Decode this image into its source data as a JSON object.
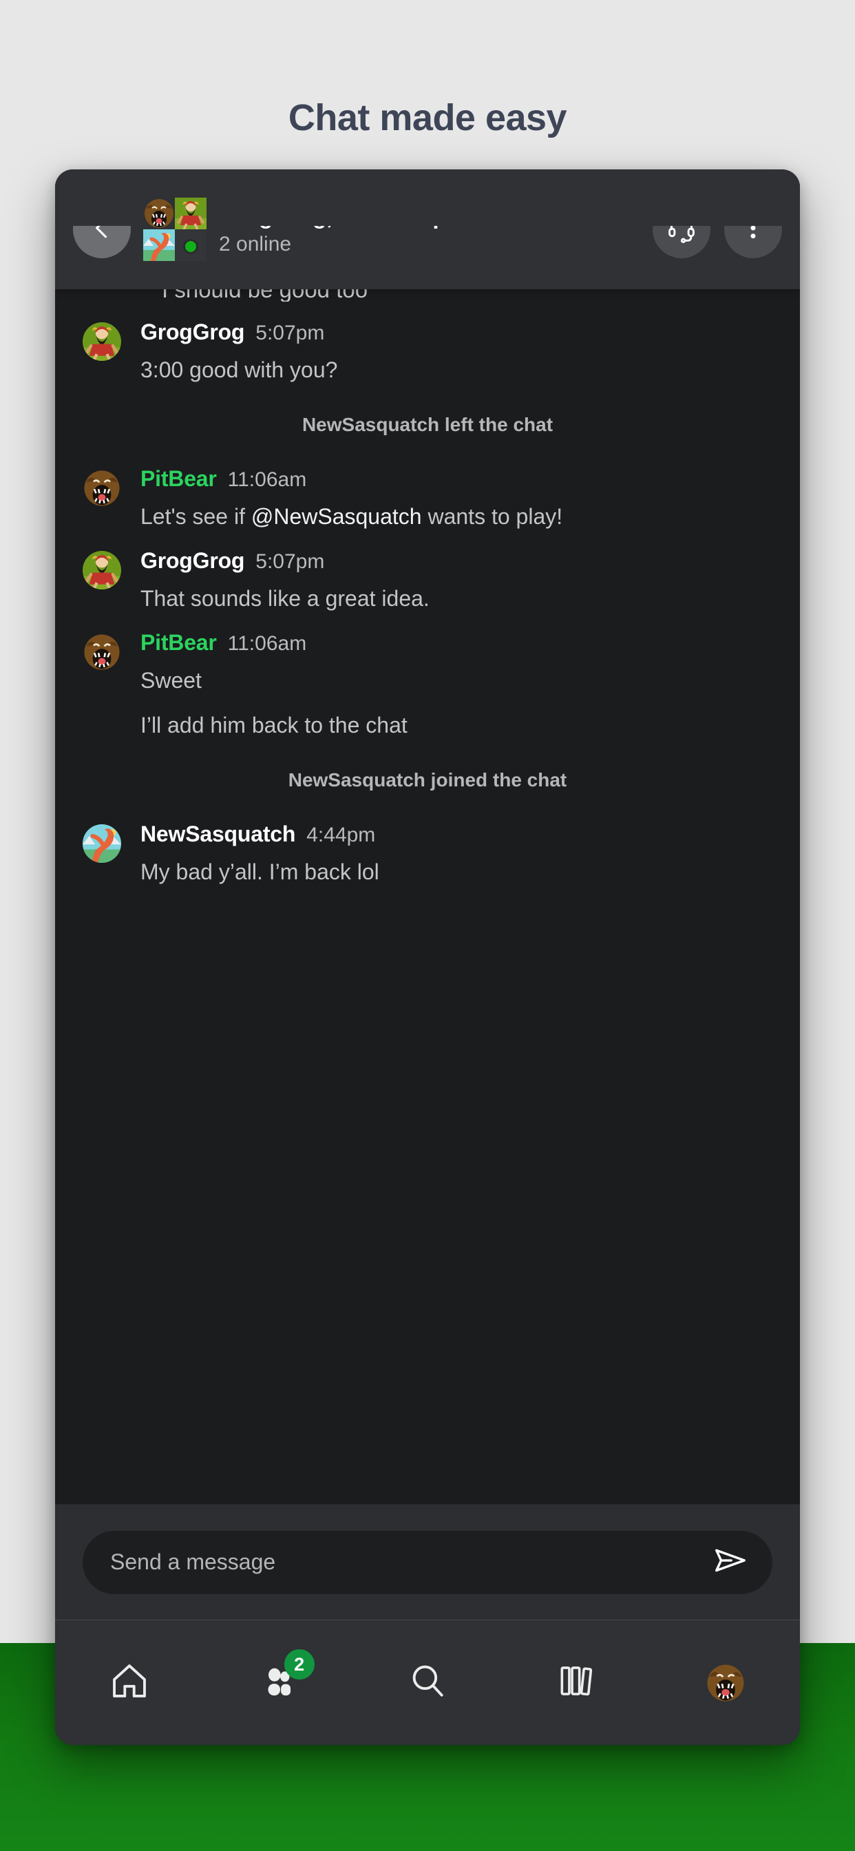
{
  "page": {
    "title": "Chat made easy",
    "background_color": "#e7e7e7",
    "accent_green": "#137a12",
    "title_color": "#3e4557"
  },
  "header": {
    "back_icon": "chevron-left-icon",
    "title": "GrogGrog, NewSasq…",
    "subtitle": "2 online",
    "presence_color": "#11b018",
    "call_icon": "headset-icon",
    "menu_icon": "more-vertical-icon",
    "avatars": [
      "pitbear-avatar",
      "groggrog-avatar",
      "newsasquatch-avatar",
      "presence-tile"
    ]
  },
  "messages": {
    "clipped_top": "I should be good too",
    "items": [
      {
        "kind": "message",
        "author": "GrogGrog",
        "author_color": "#ffffff",
        "time": "5:07pm",
        "avatar": "groggrog-avatar",
        "lines": [
          "3:00 good with you?"
        ]
      },
      {
        "kind": "system",
        "text": "NewSasquatch left the chat"
      },
      {
        "kind": "message",
        "author": "PitBear",
        "author_color": "#2bd45f",
        "time": "11:06am",
        "avatar": "pitbear-avatar",
        "lines": [
          "Let's see if @NewSasquatch wants to play!"
        ],
        "mention": "@NewSasquatch"
      },
      {
        "kind": "message",
        "author": "GrogGrog",
        "author_color": "#ffffff",
        "time": "5:07pm",
        "avatar": "groggrog-avatar",
        "lines": [
          "That sounds like a great idea."
        ]
      },
      {
        "kind": "message",
        "author": "PitBear",
        "author_color": "#2bd45f",
        "time": "11:06am",
        "avatar": "pitbear-avatar",
        "lines": [
          "Sweet",
          "I’ll add him back to the chat"
        ]
      },
      {
        "kind": "system",
        "text": "NewSasquatch joined the chat"
      },
      {
        "kind": "message",
        "author": "NewSasquatch",
        "author_color": "#ffffff",
        "time": "4:44pm",
        "avatar": "newsasquatch-avatar",
        "lines": [
          "My bad y’all. I’m back lol"
        ]
      }
    ],
    "msg_0_line_0": "3:00 good with you?",
    "sys_0": "NewSasquatch left the chat",
    "msg_1_pre": "Let's see if ",
    "msg_1_mention": "@NewSasquatch",
    "msg_1_post": " wants to play!",
    "msg_2_line_0": "That sounds like a great idea.",
    "msg_3_line_0": "Sweet",
    "msg_3_line_1": "I’ll add him back to the chat",
    "sys_1": "NewSasquatch joined the chat",
    "msg_4_line_0": "My bad y’all. I’m back lol"
  },
  "composer": {
    "placeholder": "Send a message",
    "send_icon": "send-icon"
  },
  "bottom_nav": {
    "items": [
      {
        "icon": "home-icon",
        "badge": null
      },
      {
        "icon": "people-icon",
        "badge": "2"
      },
      {
        "icon": "search-icon",
        "badge": null
      },
      {
        "icon": "library-icon",
        "badge": null
      },
      {
        "icon": "profile-avatar-icon",
        "badge": null
      }
    ],
    "badge_value": "2",
    "badge_color": "#11963f"
  }
}
